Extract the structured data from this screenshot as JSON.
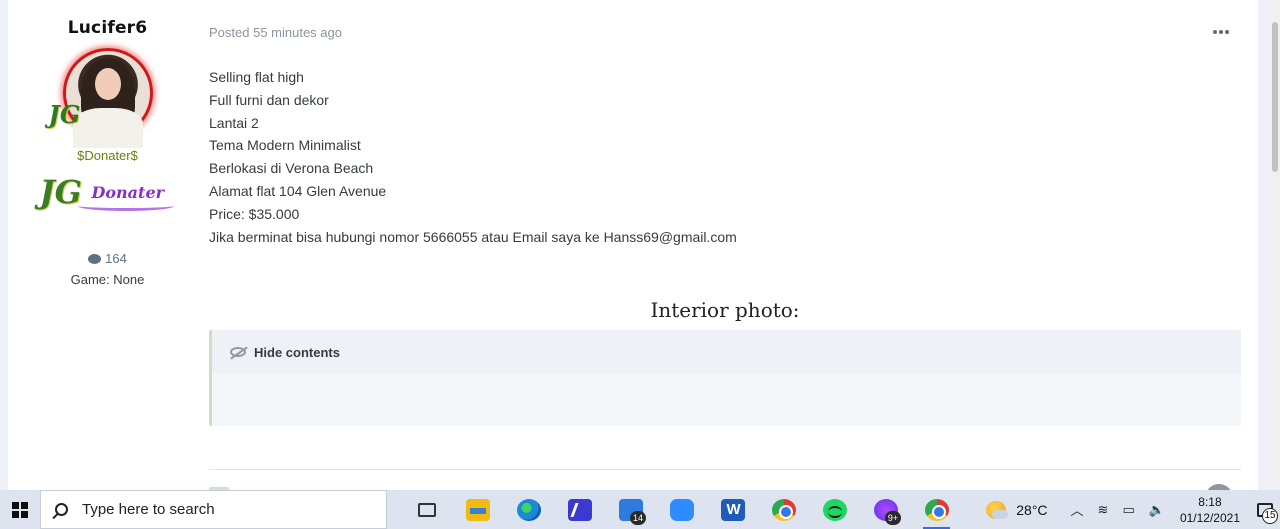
{
  "author": {
    "name": "Lucifer6",
    "group_tag": "$Donater$",
    "avatar_badge": "JG",
    "logo_text_jg": "JG",
    "logo_text_word": "Donater",
    "post_count": "164",
    "game_line": "Game: None"
  },
  "post": {
    "meta": "Posted 55 minutes ago",
    "lines": [
      "Selling flat high",
      "Full furni dan dekor",
      "Lantai 2",
      "Tema Modern Minimalist",
      "Berlokasi di Verona Beach",
      "Alamat flat 104 Glen Avenue",
      "Price: $35.000",
      "Jika berminat bisa hubungi nomor 5666055 atau Email saya ke Hanss69@gmail.com"
    ],
    "heading": "Interior photo:",
    "spoiler_label": "Hide contents"
  },
  "taskbar": {
    "search_placeholder": "Type here to search",
    "mail_badge": "14",
    "messenger_badge": "9+",
    "temperature": "28°C",
    "time": "8:18",
    "date": "01/12/2021",
    "notification_count": "15",
    "tray_chevron": "︿",
    "tray_wifi": "≋",
    "tray_battery": "▭",
    "tray_volume": "🔈"
  },
  "icons": {
    "more": "more-horizontal-icon",
    "comment": "comment-bubble-icon",
    "eye": "eye-slash-icon"
  },
  "colors": {
    "avatar_ring": "#d01818",
    "group_tag": "#6c7c14",
    "accent_blue": "#3a6bd6",
    "spoiler_border": "#c9e0c2"
  }
}
